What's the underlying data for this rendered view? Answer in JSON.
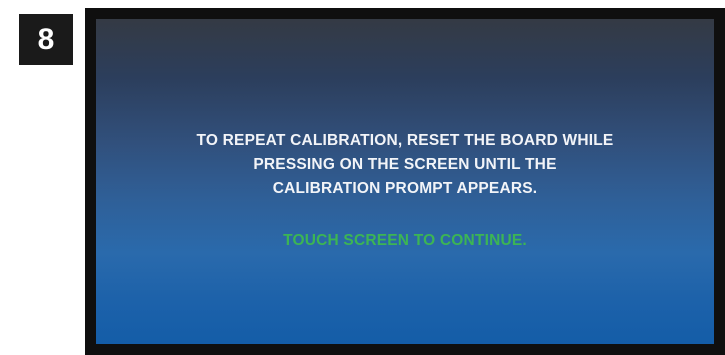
{
  "step": {
    "number": "8"
  },
  "screen": {
    "message_lines": [
      "TO REPEAT CALIBRATION, RESET THE BOARD WHILE",
      "PRESSING ON THE SCREEN UNTIL THE",
      "CALIBRATION PROMPT APPEARS."
    ],
    "prompt": "TOUCH SCREEN TO CONTINUE."
  },
  "colors": {
    "badge_bg": "#1a1a1a",
    "bezel": "#0f0f0f",
    "screen_top": "#343a44",
    "screen_bottom": "#145da8",
    "message_text": "#f2f4f8",
    "prompt_text": "#3cb554"
  }
}
